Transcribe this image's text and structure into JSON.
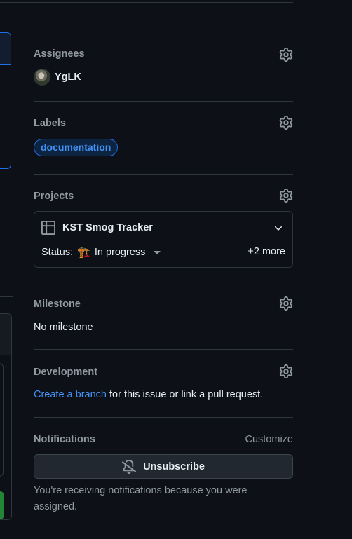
{
  "sidebar": {
    "assignees": {
      "title": "Assignees",
      "users": [
        {
          "name": "YgLK"
        }
      ]
    },
    "labels": {
      "title": "Labels",
      "items": [
        {
          "name": "documentation",
          "color": "#4493f8"
        }
      ]
    },
    "projects": {
      "title": "Projects",
      "project": {
        "name": "KST Smog Tracker",
        "status_label": "Status:",
        "status_emoji": "🏗️",
        "status_value": "In progress",
        "more": "+2 more"
      }
    },
    "milestone": {
      "title": "Milestone",
      "value": "No milestone"
    },
    "development": {
      "title": "Development",
      "link_text": "Create a branch",
      "rest_text": " for this issue or link a pull request."
    },
    "notifications": {
      "title": "Notifications",
      "customize_label": "Customize",
      "button_label": "Unsubscribe",
      "note": "You're receiving notifications because you were assigned."
    }
  },
  "left_column": {
    "partial_mark": "⋮"
  },
  "colors": {
    "background": "#0d1117",
    "border": "#30363d",
    "accent_link": "#4493f8",
    "muted_text": "#9198a1",
    "primary_text": "#e6edf3"
  }
}
